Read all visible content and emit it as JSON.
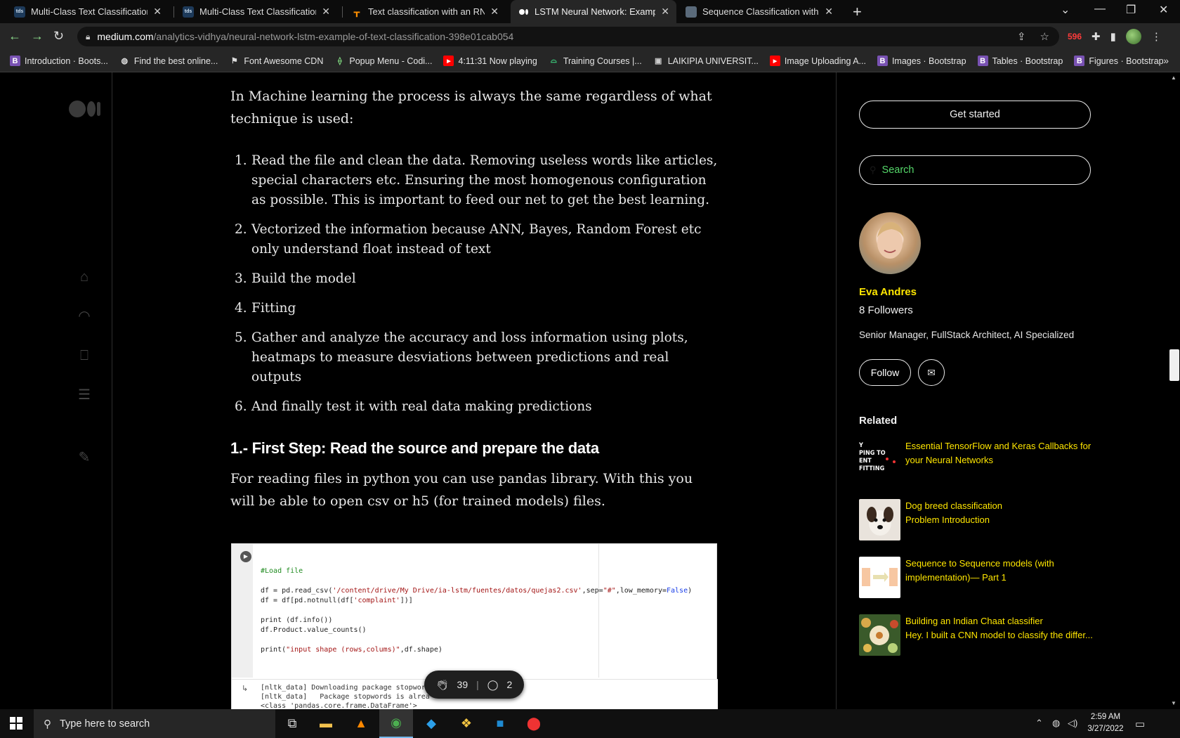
{
  "browser": {
    "tabs": [
      {
        "label": "Multi-Class Text Classification wit",
        "favicon": "tds"
      },
      {
        "label": "Multi-Class Text Classification Mc",
        "favicon": "tds"
      },
      {
        "label": "Text classification with an RNN  |",
        "favicon": "tf"
      },
      {
        "label": "LSTM Neural Network: Example c",
        "favicon": "medium"
      },
      {
        "label": "Sequence Classification with LST",
        "favicon": "img"
      }
    ],
    "url_host": "medium.com",
    "url_path": "/analytics-vidhya/neural-network-lstm-example-of-text-classification-398e01cab054",
    "ext_badge": "596",
    "bookmarks": [
      {
        "label": "Introduction · Boots...",
        "icon": "bootstrap-icon"
      },
      {
        "label": "Find the best online...",
        "icon": "globe-icon"
      },
      {
        "label": "Font Awesome CDN",
        "icon": "flag-icon"
      },
      {
        "label": "Popup Menu - Codi...",
        "icon": "codepen-icon"
      },
      {
        "label": "4:11:31 Now playing",
        "icon": "youtube-icon"
      },
      {
        "label": "Training Courses |...",
        "icon": "android-icon"
      },
      {
        "label": "LAIKIPIA UNIVERSIT...",
        "icon": "university-icon"
      },
      {
        "label": "Image Uploading A...",
        "icon": "youtube-icon"
      },
      {
        "label": "Images · Bootstrap",
        "icon": "bootstrap-icon"
      },
      {
        "label": "Tables · Bootstrap",
        "icon": "bootstrap-icon"
      },
      {
        "label": "Figures · Bootstrap",
        "icon": "bootstrap-icon"
      }
    ]
  },
  "article": {
    "intro": "In Machine learning the process is always the same regardless of what technique is used:",
    "steps": [
      "Read the file and clean the data. Removing useless words like articles, special characters etc. Ensuring the most homogenous configuration as possible. This is important to feed our net to get the best learning.",
      "Vectorized the information because ANN, Bayes, Random Forest etc only understand float instead of text",
      "Build the model",
      "Fitting",
      "Gather and analyze the accuracy and loss information using plots, heatmaps to measure desviations between predictions and real outputs",
      "And finally test it with real data making predictions"
    ],
    "step_numbers": [
      "1.",
      "2.",
      "3.",
      "4.",
      "5.",
      "6."
    ],
    "heading": "1.- First Step: Read the source and prepare the data",
    "paragraph": "For reading files in python you can use pandas library. With this you will be able to open csv or h5 (for trained models) files.",
    "code": {
      "comment": "#Load file",
      "line1_a": "df = pd.read_csv(",
      "line1_str": "'/content/drive/My Drive/ia-lstm/fuentes/datos/quejas2.csv'",
      "line1_b": ",sep=",
      "line1_sep": "\"#\"",
      "line1_c": ",low_memory=",
      "line1_false": "False",
      "line1_d": ")",
      "line2_a": "df = df[pd.notnull(df[",
      "line2_str": "'complaint'",
      "line2_b": "])]",
      "line3": "print (df.info())",
      "line4": "df.Product.value_counts()",
      "line5_a": "print(",
      "line5_str": "\"input shape (rows,colums)\"",
      "line5_b": ",df.shape)",
      "out1": "[nltk_data] Downloading package stopwor",
      "out2": "[nltk_data]   Package stopwords is alrea",
      "out3": "<class 'pandas.core.frame.DataFrame'>"
    },
    "claps": "39",
    "responses": "2"
  },
  "sidebar": {
    "get_started": "Get started",
    "search_placeholder": "Search",
    "author_name": "Eva Andres",
    "followers": "8 Followers",
    "bio": "Senior Manager, FullStack Architect, AI Specialized",
    "follow": "Follow",
    "related_heading": "Related",
    "related": [
      {
        "title": "Essential TensorFlow and Keras Callbacks for your Neural Networks",
        "thumb_text": "Y\nPING TO\nENT\nFITTING"
      },
      {
        "title": "Dog breed classification\nProblem Introduction"
      },
      {
        "title": "Sequence to Sequence models (with implementation)— Part 1"
      },
      {
        "title": "Building an Indian Chaat classifier\nHey. I built a CNN model to classify the differ..."
      }
    ]
  },
  "taskbar": {
    "search_placeholder": "Type here to search",
    "time": "2:59 AM",
    "date": "3/27/2022"
  },
  "colors": {
    "accent_yellow": "#ffe600",
    "search_green": "#55d86a",
    "page_bg": "#000000"
  }
}
